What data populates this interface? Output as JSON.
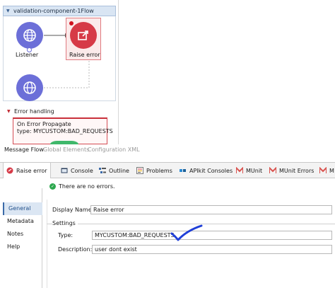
{
  "flow": {
    "title": "validation-component-1Flow",
    "nodes": {
      "listener_label": "Listener",
      "raise_label": "Raise error"
    },
    "error_handling": {
      "title": "Error handling",
      "propagate_line1": "On Error Propagate",
      "propagate_line2": "type: MYCUSTOM:BAD_REQUESTS"
    }
  },
  "editor_tabs": [
    "Message Flow",
    "Global Elements",
    "Configuration XML"
  ],
  "view_tabs": [
    {
      "label": "Raise error",
      "icon": "raise-error-icon"
    },
    {
      "label": "Console",
      "icon": "console-icon"
    },
    {
      "label": "Outline",
      "icon": "outline-icon"
    },
    {
      "label": "Problems",
      "icon": "problems-icon"
    },
    {
      "label": "APIkit Consoles",
      "icon": "apikit-icon"
    },
    {
      "label": "MUnit",
      "icon": "munit-icon"
    },
    {
      "label": "MUnit Errors",
      "icon": "munit-errors-icon"
    },
    {
      "label": "M",
      "icon": "munit-icon"
    }
  ],
  "side_nav": [
    "General",
    "Metadata",
    "Notes",
    "Help"
  ],
  "status": "There are no errors.",
  "form": {
    "display_name_label": "Display Name:",
    "display_name_value": "Raise error",
    "settings_title": "Settings",
    "type_label": "Type:",
    "type_value": "MYCUSTOM:BAD_REQUESTS",
    "description_label": "Description:",
    "description_value": "user dont exist"
  },
  "colors": {
    "accent_blue": "#3b6aa8",
    "node_purple": "#6c6fd8",
    "node_red": "#d63a47",
    "ok_green": "#2ea84f",
    "annotation_blue": "#1f3fd8"
  }
}
